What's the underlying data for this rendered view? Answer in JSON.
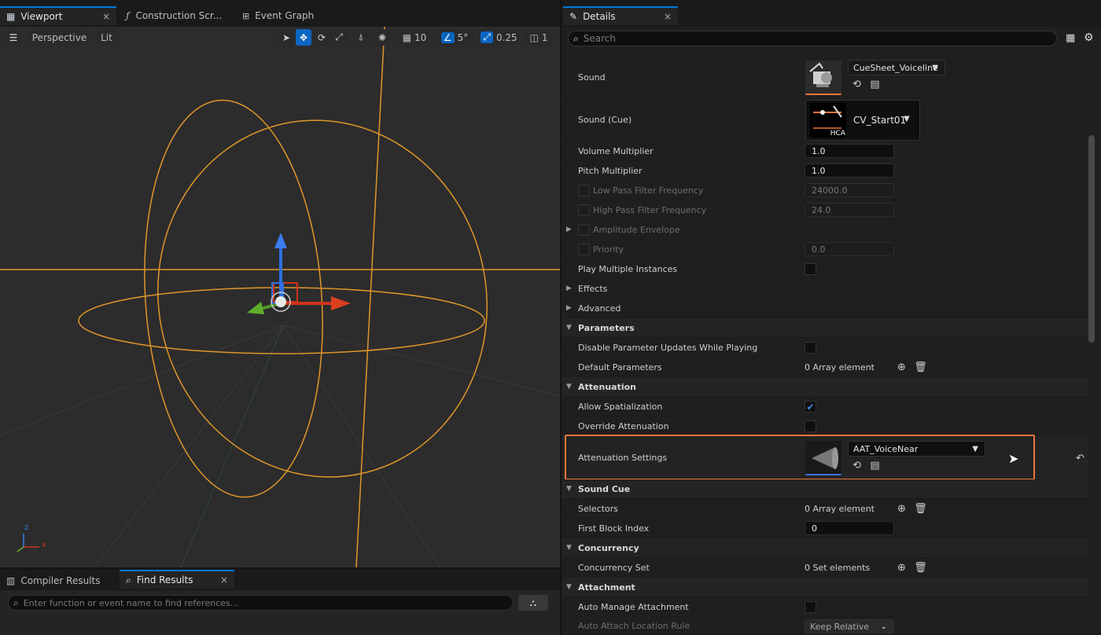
{
  "left_tabs": [
    {
      "label": "Viewport",
      "close": "×"
    },
    {
      "label": "Construction Scr..."
    },
    {
      "label": "Event Graph"
    }
  ],
  "viewport_toolbar": {
    "perspective": "Perspective",
    "lit": "Lit",
    "grid": "10",
    "angle": "5°",
    "scale": "0.25",
    "cam": "1"
  },
  "axis": {
    "z": "z",
    "x": "x"
  },
  "bottom_tabs": [
    {
      "label": "Compiler Results"
    },
    {
      "label": "Find Results",
      "close": "×"
    }
  ],
  "find": {
    "placeholder": "Enter function or event name to find references..."
  },
  "details": {
    "tab": "Details",
    "close": "×",
    "search_placeholder": "Search",
    "sound": {
      "label": "Sound",
      "value": "CueSheet_Voiceline"
    },
    "sound_cue": {
      "label": "Sound (Cue)",
      "value": "CV_Start01",
      "thumb_text": "HCA"
    },
    "volume": {
      "label": "Volume Multiplier",
      "value": "1.0"
    },
    "pitch": {
      "label": "Pitch Multiplier",
      "value": "1.0"
    },
    "lowpass": {
      "label": "Low Pass Filter Frequency",
      "value": "24000.0"
    },
    "highpass": {
      "label": "High Pass Filter Frequency",
      "value": "24.0"
    },
    "amp": {
      "label": "Amplitude Envelope"
    },
    "priority": {
      "label": "Priority",
      "value": "0.0"
    },
    "play_multi": {
      "label": "Play Multiple Instances"
    },
    "effects": "Effects",
    "advanced": "Advanced",
    "parameters": {
      "label": "Parameters",
      "disable": "Disable Parameter Updates While Playing",
      "default": "Default Parameters",
      "default_val": "0 Array element"
    },
    "attenuation": {
      "label": "Attenuation",
      "allow": "Allow Spatialization",
      "override": "Override Attenuation",
      "settings": "Attenuation Settings",
      "settings_val": "AAT_VoiceNear"
    },
    "sound_cue_cat": {
      "label": "Sound Cue",
      "selectors": "Selectors",
      "selectors_val": "0 Array element",
      "first_block": "First Block Index",
      "first_block_val": "0"
    },
    "concurrency": {
      "label": "Concurrency",
      "set": "Concurrency Set",
      "set_val": "0 Set elements"
    },
    "attachment": {
      "label": "Attachment",
      "auto_manage": "Auto Manage Attachment",
      "auto_rule": "Auto Attach Location Rule",
      "auto_rule_val": "Keep Relative"
    }
  },
  "colors": {
    "accent": "#0a66c2",
    "highlight": "#e8743b",
    "orange_line": "#e0962a"
  }
}
